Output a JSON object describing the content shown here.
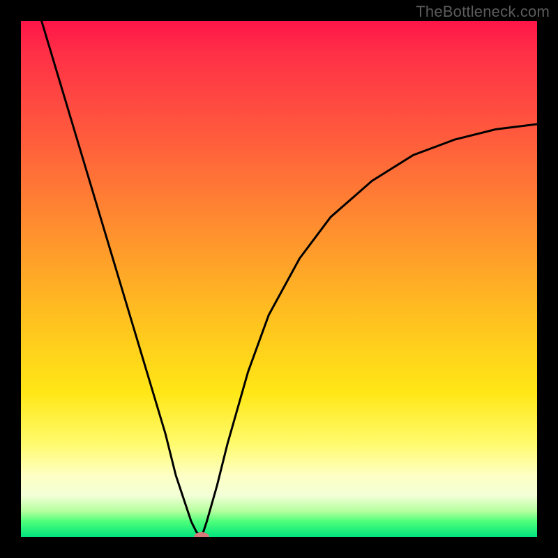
{
  "watermark": "TheBottleneck.com",
  "chart_data": {
    "type": "line",
    "title": "",
    "xlabel": "",
    "ylabel": "",
    "xlim": [
      0,
      100
    ],
    "ylim": [
      0,
      100
    ],
    "series": [
      {
        "name": "left-curve",
        "x": [
          4,
          7,
          10,
          13,
          16,
          19,
          22,
          25,
          28,
          30,
          32,
          33,
          34,
          35
        ],
        "values": [
          100,
          90,
          80,
          70,
          60,
          50,
          40,
          30,
          20,
          12,
          6,
          3,
          1,
          0
        ]
      },
      {
        "name": "right-curve",
        "x": [
          35,
          36,
          38,
          40,
          44,
          48,
          54,
          60,
          68,
          76,
          84,
          92,
          100
        ],
        "values": [
          0,
          3,
          10,
          18,
          32,
          43,
          54,
          62,
          69,
          74,
          77,
          79,
          80
        ]
      }
    ],
    "marker": {
      "x": 35,
      "y": 0,
      "color": "#d87a7a"
    },
    "gradient_stops": [
      {
        "pos": 0,
        "color": "#ff1548"
      },
      {
        "pos": 22,
        "color": "#ff5a3d"
      },
      {
        "pos": 40,
        "color": "#ff8e2f"
      },
      {
        "pos": 58,
        "color": "#ffc21f"
      },
      {
        "pos": 72,
        "color": "#ffe716"
      },
      {
        "pos": 88,
        "color": "#feffc4"
      },
      {
        "pos": 97,
        "color": "#4dff7a"
      },
      {
        "pos": 100,
        "color": "#00e37e"
      }
    ]
  }
}
